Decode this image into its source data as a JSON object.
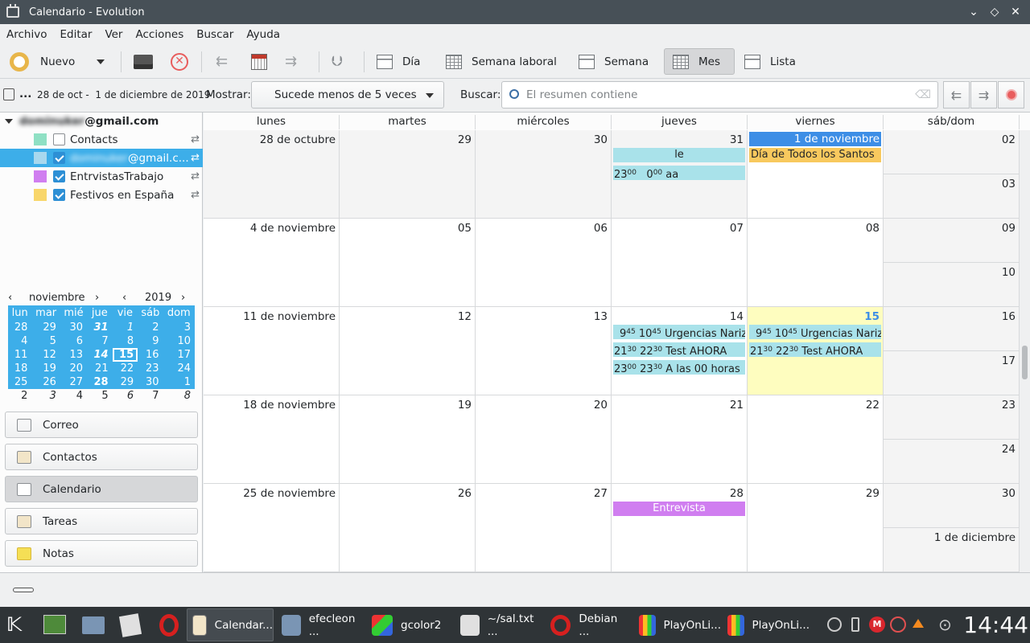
{
  "window": {
    "title": "Calendario - Evolution"
  },
  "menu": [
    "Archivo",
    "Editar",
    "Ver",
    "Acciones",
    "Buscar",
    "Ayuda"
  ],
  "toolbar": {
    "new_label": "Nuevo",
    "views": {
      "day": "Día",
      "workweek": "Semana laboral",
      "week": "Semana",
      "month": "Mes",
      "list": "Lista"
    }
  },
  "filter": {
    "range": "28 de oct -  1 de diciembre de 2019",
    "ellipsis": "...",
    "show_label": "Mostrar:",
    "show_value": "Sucede menos de 5 veces",
    "search_label": "Buscar:",
    "search_placeholder": "El resumen contiene"
  },
  "sources": {
    "account_hidden": "dominuker",
    "account_domain": "@gmail.com",
    "items": [
      {
        "name": "Contacts",
        "color": "#8fe0c4",
        "checked": false
      },
      {
        "name_hidden": "dominuker",
        "name_suffix": "@gmail.c...",
        "color": "#a8d8ee",
        "checked": true
      },
      {
        "name": "EntrvistasTrabajo",
        "color": "#d07ef0",
        "checked": true
      },
      {
        "name": "Festivos en España",
        "color": "#f8d66a",
        "checked": true
      }
    ]
  },
  "minical": {
    "month": "noviembre",
    "year": "2019",
    "weekdays": [
      "lun",
      "mar",
      "mié",
      "jue",
      "vie",
      "sáb",
      "dom"
    ],
    "weeks": [
      [
        "28",
        "29",
        "30",
        "31",
        "1",
        "2",
        "3"
      ],
      [
        "4",
        "5",
        "6",
        "7",
        "8",
        "9",
        "10"
      ],
      [
        "11",
        "12",
        "13",
        "14",
        "15",
        "16",
        "17"
      ],
      [
        "18",
        "19",
        "20",
        "21",
        "22",
        "23",
        "24"
      ],
      [
        "25",
        "26",
        "27",
        "28",
        "29",
        "30",
        "1"
      ],
      [
        "2",
        "3",
        "4",
        "5",
        "6",
        "7",
        "8"
      ]
    ]
  },
  "switcher": [
    "Correo",
    "Contactos",
    "Calendario",
    "Tareas",
    "Notas"
  ],
  "month_view": {
    "headers": [
      "lunes",
      "martes",
      "miércoles",
      "jueves",
      "viernes",
      "sáb/dom"
    ],
    "rows": [
      {
        "days": [
          "28 de octubre",
          "29",
          "30",
          "31",
          "1 de noviembre"
        ],
        "sat": "02",
        "sun": "03"
      },
      {
        "days": [
          "4 de noviembre",
          "05",
          "06",
          "07",
          "08"
        ],
        "sat": "09",
        "sun": "10"
      },
      {
        "days": [
          "11 de noviembre",
          "12",
          "13",
          "14",
          "15"
        ],
        "sat": "16",
        "sun": "17"
      },
      {
        "days": [
          "18 de noviembre",
          "19",
          "20",
          "21",
          "22"
        ],
        "sat": "23",
        "sun": "24"
      },
      {
        "days": [
          "25 de noviembre",
          "26",
          "27",
          "28",
          "29"
        ],
        "sat": "30",
        "sun": "1 de diciembre"
      }
    ],
    "events": {
      "le": "le",
      "aa": {
        "s": "23",
        "sm": "00",
        "e": "0",
        "em": "00",
        "title": "aa"
      },
      "todos_santos": "Día de Todos los Santos",
      "urg": {
        "s": "9",
        "sm": "45",
        "e": "10",
        "em": "45",
        "title": "Urgencias Nariz"
      },
      "test": {
        "s": "21",
        "sm": "30",
        "e": "22",
        "em": "30",
        "title": "Test AHORA"
      },
      "once": {
        "s": "23",
        "sm": "00",
        "e": "23",
        "em": "30",
        "title": "A las 00 horas"
      },
      "entrevista": "Entrevista"
    }
  },
  "taskbar": {
    "tasks": [
      "Calendar...",
      "efecleon ...",
      "gcolor2",
      "~/sal.txt ...",
      "Debian ...",
      "PlayOnLi...",
      "PlayOnLi..."
    ],
    "clock": "14:44"
  }
}
